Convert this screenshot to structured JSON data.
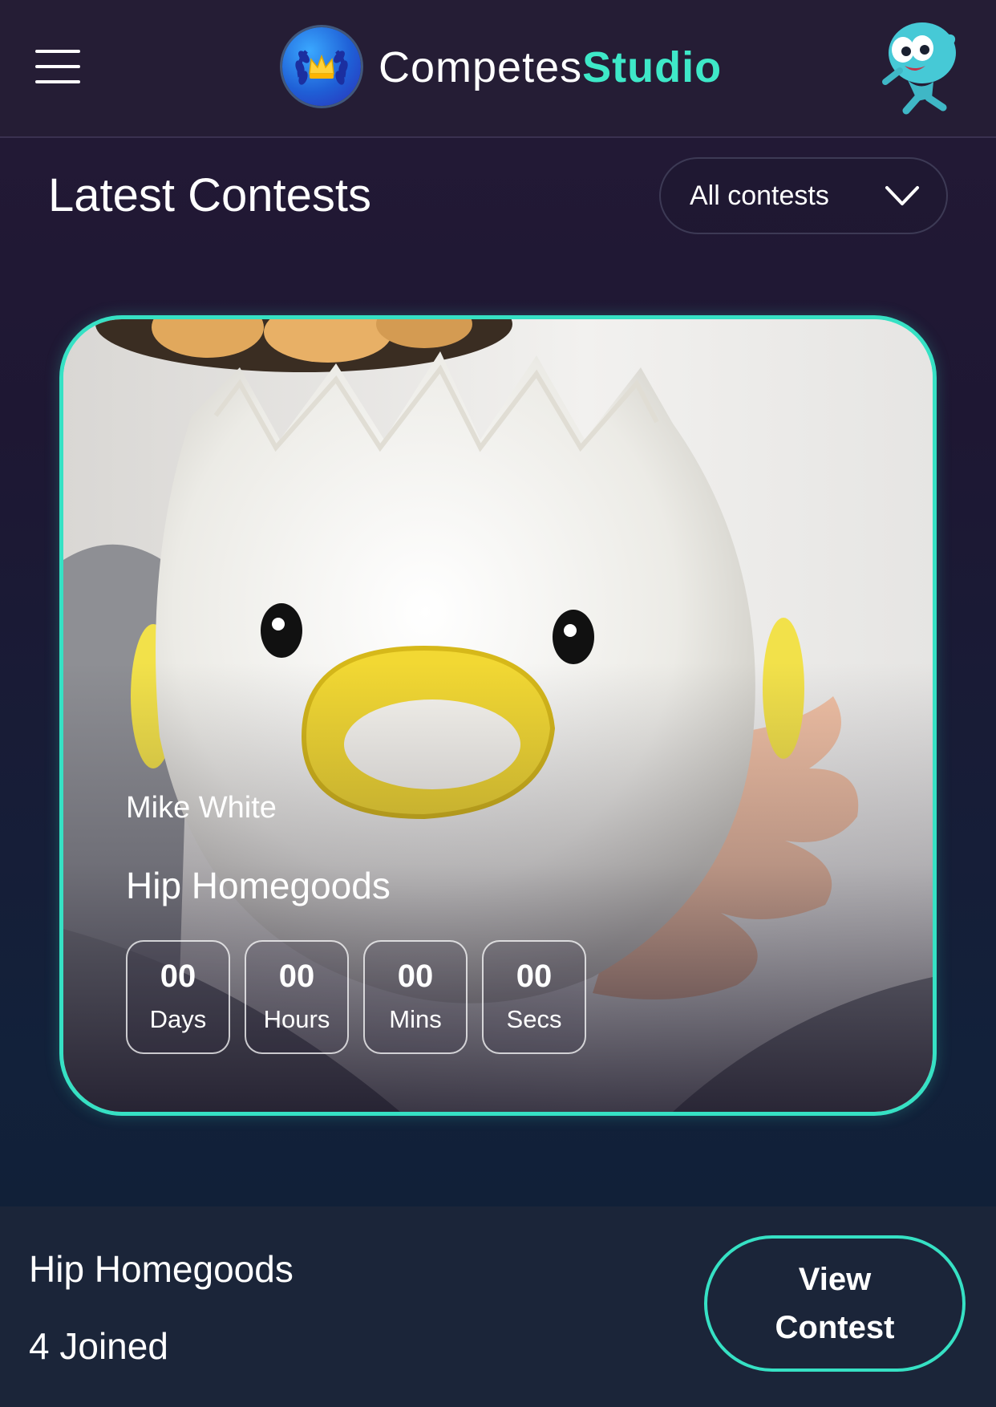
{
  "header": {
    "brand_part1": "Competes",
    "brand_part2": "Studio",
    "menu_icon": "hamburger-menu-icon",
    "logo_icon": "crown-laurel-logo-icon",
    "avatar_icon": "alien-mascot-icon"
  },
  "section": {
    "title": "Latest Contests",
    "filter_label": "All contests",
    "filter_icon": "chevron-down-icon"
  },
  "card": {
    "image": "duck-egg-separator-photo",
    "creator": "Mike White",
    "name": "Hip Homegoods",
    "timer": [
      {
        "value": "00",
        "unit": "Days"
      },
      {
        "value": "00",
        "unit": "Hours"
      },
      {
        "value": "00",
        "unit": "Mins"
      },
      {
        "value": "00",
        "unit": "Secs"
      }
    ]
  },
  "footer": {
    "name": "Hip Homegoods",
    "joined": "4 Joined",
    "button_label": "View Contest"
  },
  "colors": {
    "accent": "#36e1c4",
    "brand_green": "#3ee8c8",
    "header_bg": "#251d35",
    "footer_bg": "#1b2539"
  }
}
